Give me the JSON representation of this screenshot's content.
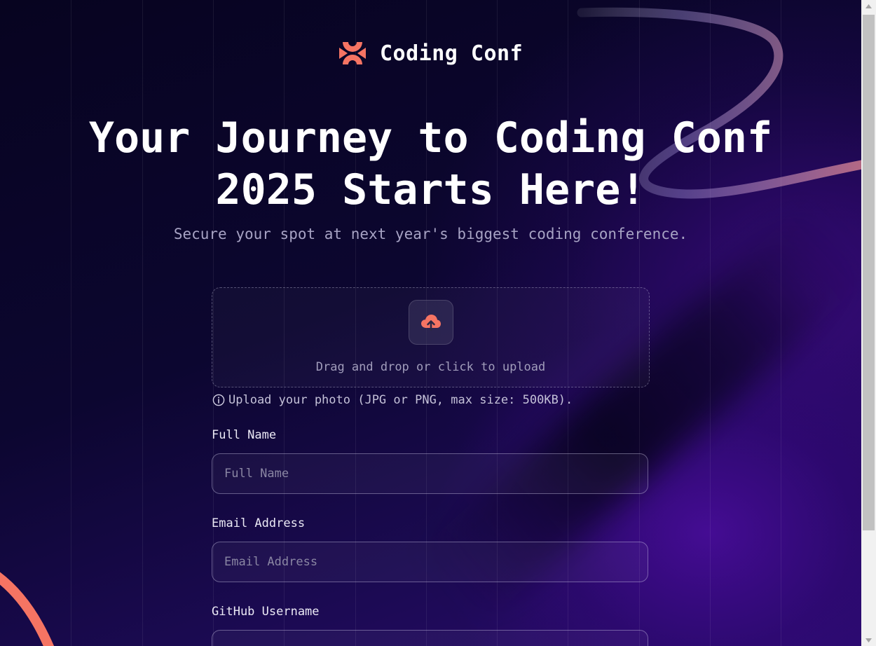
{
  "colors": {
    "accent": "#f57463",
    "background": "#0a0625",
    "text": "#ffffff",
    "muted_text": "#a7a3c4"
  },
  "brand": {
    "name": "Coding Conf",
    "logo_icon": "coding-conf-logo-icon"
  },
  "hero": {
    "title": "Your Journey to Coding Conf 2025 Starts Here!",
    "subtitle": "Secure your spot at next year's biggest coding conference."
  },
  "upload": {
    "icon": "upload-cloud-icon",
    "prompt": "Drag and drop or click to upload",
    "hint_icon": "info-icon",
    "hint": "Upload your photo (JPG or PNG, max size: 500KB)."
  },
  "form": {
    "full_name": {
      "label": "Full Name",
      "placeholder": "Full Name",
      "value": ""
    },
    "email": {
      "label": "Email Address",
      "placeholder": "Email Address",
      "value": ""
    },
    "github": {
      "label": "GitHub Username",
      "placeholder": "",
      "value": ""
    }
  }
}
